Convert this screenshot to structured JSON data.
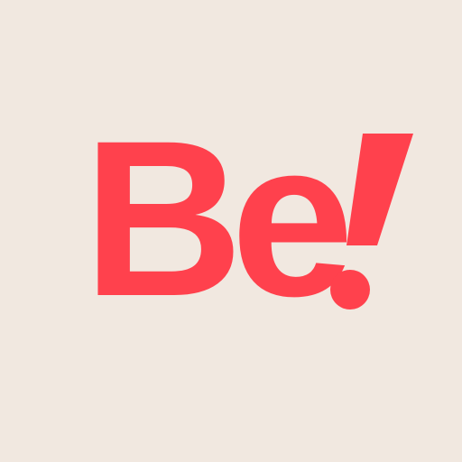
{
  "logo": {
    "text": "Be",
    "mark": "!",
    "color": "#ff414d",
    "background": "#f1e8e0"
  }
}
